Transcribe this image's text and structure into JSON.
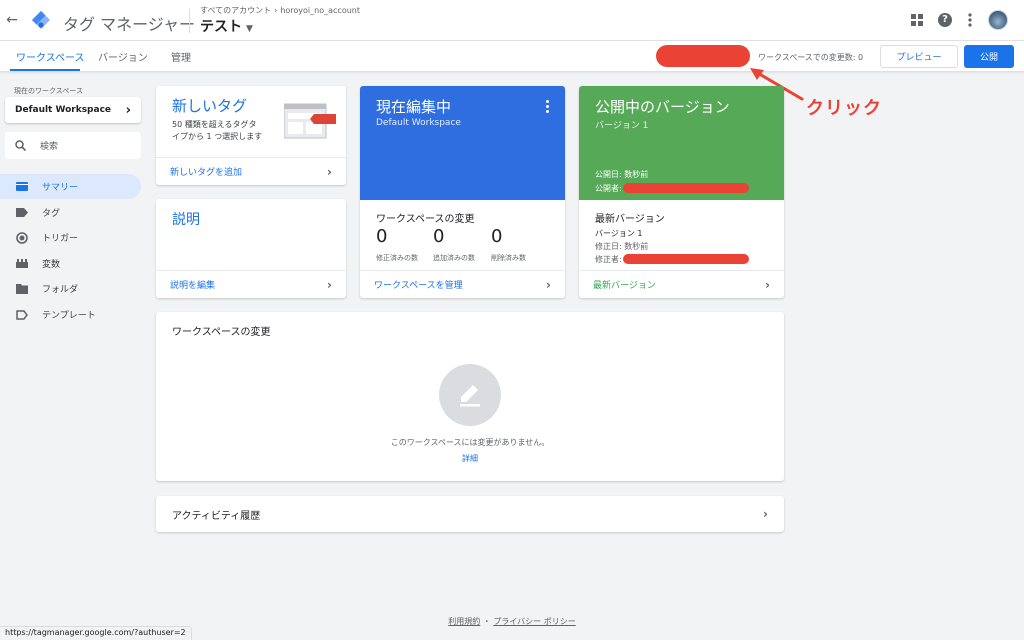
{
  "header": {
    "app_title": "タグ マネージャー",
    "breadcrumb_root": "すべてのアカウント",
    "breadcrumb_account": "horoyoi_no_account",
    "container_name": "テスト",
    "icons": [
      "apps-grid-icon",
      "help-icon",
      "more-vert-icon",
      "avatar"
    ]
  },
  "tabs": [
    "ワークスペース",
    "バージョン",
    "管理"
  ],
  "toolbar": {
    "ws_changes": "ワークスペースでの変更数: 0",
    "preview": "プレビュー",
    "publish": "公開"
  },
  "annotation": {
    "text": "クリック",
    "color": "#ea4335"
  },
  "sidebar": {
    "ws_label": "現在のワークスペース",
    "ws_value": "Default Workspace",
    "search_placeholder": "検索",
    "items": [
      {
        "label": "サマリー",
        "icon": "summary-icon"
      },
      {
        "label": "タグ",
        "icon": "tag-icon"
      },
      {
        "label": "トリガー",
        "icon": "trigger-icon"
      },
      {
        "label": "変数",
        "icon": "variables-icon"
      },
      {
        "label": "フォルダ",
        "icon": "folder-icon"
      },
      {
        "label": "テンプレート",
        "icon": "template-icon"
      }
    ]
  },
  "cards": {
    "new_tag": {
      "title": "新しいタグ",
      "desc": "50 種類を超えるタグタイプから 1 つ選択します",
      "link": "新しいタグを追加"
    },
    "description": {
      "title": "説明",
      "link": "説明を編集"
    },
    "editing": {
      "title": "現在編集中",
      "subtitle": "Default Workspace",
      "changes_title": "ワークスペースの変更",
      "counts": [
        {
          "value": "0",
          "label": "修正済みの数"
        },
        {
          "value": "0",
          "label": "追加済みの数"
        },
        {
          "value": "0",
          "label": "削除済み数"
        }
      ],
      "link": "ワークスペースを管理"
    },
    "live": {
      "title": "公開中のバージョン",
      "subtitle": "バージョン 1",
      "published_date": "公開日: 数秒前",
      "published_by": "公開者:",
      "latest_title": "最新バージョン",
      "latest_version": "バージョン 1",
      "modified_date": "修正日: 数秒前",
      "modified_by": "修正者:",
      "link": "最新バージョン"
    },
    "ws_changes": {
      "title": "ワークスペースの変更",
      "empty_text": "このワークスペースには変更がありません。",
      "details_link": "詳細"
    },
    "activity": {
      "title": "アクティビティ履歴"
    }
  },
  "footer": {
    "terms": "利用規約",
    "separator": "・",
    "privacy": "プライバシー ポリシー"
  },
  "status_url": "https://tagmanager.google.com/?authuser=2",
  "colors": {
    "accent": "#1a73e8",
    "editing_header": "#2f6ee0",
    "live_header": "#56a957",
    "redaction": "#ea4335"
  }
}
